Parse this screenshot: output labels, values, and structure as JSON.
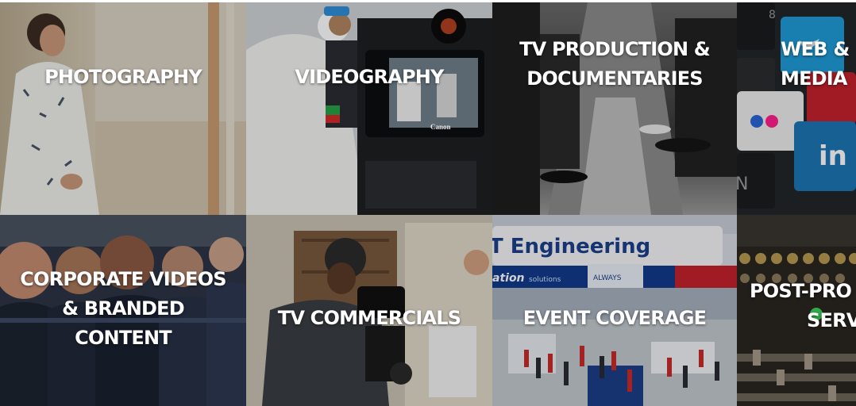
{
  "tiles": [
    {
      "lines": [
        "PHOTOGRAPHY"
      ]
    },
    {
      "lines": [
        "VIDEOGRAPHY"
      ]
    },
    {
      "lines": [
        "TV PRODUCTION &",
        "DOCUMENTARIES"
      ]
    },
    {
      "lines": [
        "WEB &",
        "MEDIA"
      ]
    },
    {
      "lines": [
        "CORPORATE VIDEOS",
        "& BRANDED",
        "CONTENT"
      ]
    },
    {
      "lines": [
        "TV COMMERCIALS"
      ]
    },
    {
      "lines": [
        "EVENT COVERAGE"
      ]
    },
    {
      "lines": [
        "POST-PRO",
        "SERV"
      ]
    }
  ],
  "photo_signage": {
    "camera_brand": "Canon",
    "booth_sign": "T Engineering",
    "banner_left": "ation",
    "banner_sub": "solutions",
    "banner_right": "ALWAYS",
    "keycap_text": "in"
  },
  "colors": {
    "label_text": "#ffffff",
    "twitter_key": "#1e9bd7",
    "linkedin_key": "#1b76b4",
    "flickr_blue": "#2a64d6",
    "flickr_pink": "#ff1f8a",
    "booth_navy": "#123a8a",
    "booth_red": "#c4222c"
  },
  "icons": [
    "twitter-icon",
    "flickr-icon",
    "linkedin-icon",
    "camera-icon"
  ]
}
